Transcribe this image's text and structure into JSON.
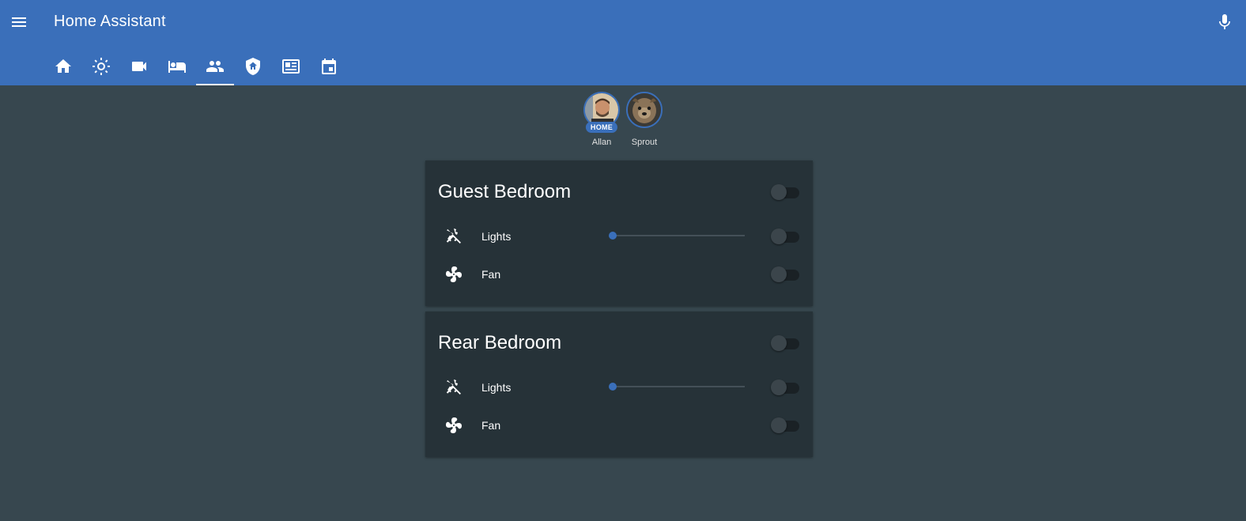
{
  "app": {
    "title": "Home Assistant"
  },
  "header": {
    "menu_icon": "menu-icon",
    "mic_icon": "microphone-icon",
    "tabs": [
      {
        "icon": "home-icon",
        "active": false
      },
      {
        "icon": "weather-sunny-icon",
        "active": false
      },
      {
        "icon": "video-camera-icon",
        "active": false
      },
      {
        "icon": "bed-icon",
        "active": false
      },
      {
        "icon": "account-group-icon",
        "active": true
      },
      {
        "icon": "shield-home-icon",
        "active": false
      },
      {
        "icon": "newspaper-icon",
        "active": false
      },
      {
        "icon": "calendar-icon",
        "active": false
      }
    ]
  },
  "badges": [
    {
      "name": "Allan",
      "state_label": "HOME"
    },
    {
      "name": "Sprout",
      "state_label": ""
    }
  ],
  "cards": [
    {
      "title": "Guest Bedroom",
      "toggle_on": false,
      "rows": [
        {
          "icon": "lightbulb-off-icon",
          "label": "Lights",
          "slider_level": 0,
          "toggle_on": false
        },
        {
          "icon": "fan-icon",
          "label": "Fan",
          "toggle_on": false
        }
      ]
    },
    {
      "title": "Rear Bedroom",
      "toggle_on": false,
      "rows": [
        {
          "icon": "lightbulb-off-icon",
          "label": "Lights",
          "slider_level": 0,
          "toggle_on": false
        },
        {
          "icon": "fan-icon",
          "label": "Fan",
          "toggle_on": false
        }
      ]
    }
  ],
  "colors": {
    "primary": "#3a6fba",
    "background": "#37474f",
    "card": "#263238"
  }
}
